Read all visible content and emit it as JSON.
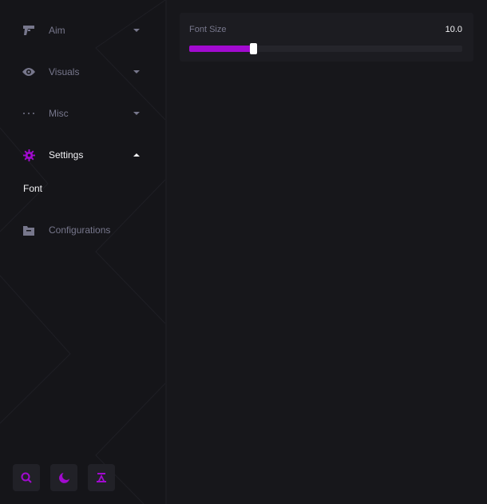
{
  "sidebar": {
    "items": [
      {
        "label": "Aim",
        "icon": "gun-icon",
        "expanded": false
      },
      {
        "label": "Visuals",
        "icon": "eye-icon",
        "expanded": false
      },
      {
        "label": "Misc",
        "icon": "dots-icon",
        "expanded": false
      },
      {
        "label": "Settings",
        "icon": "gear-icon",
        "expanded": true
      },
      {
        "label": "Configurations",
        "icon": "folder-icon",
        "expanded": false
      }
    ],
    "settings_subitems": [
      {
        "label": "Font"
      }
    ],
    "bottom_buttons": [
      {
        "icon": "search-icon"
      },
      {
        "icon": "moon-icon"
      },
      {
        "icon": "user-icon"
      }
    ]
  },
  "main": {
    "slider": {
      "label": "Font Size",
      "value_text": "10.0",
      "fill_fraction": 0.235
    }
  },
  "colors": {
    "accent": "#a20ad0",
    "background": "#17171b",
    "sidebar": "#151519",
    "panel": "#1c1c21",
    "text_muted": "#77778c",
    "text_active": "#f2f2f5"
  }
}
